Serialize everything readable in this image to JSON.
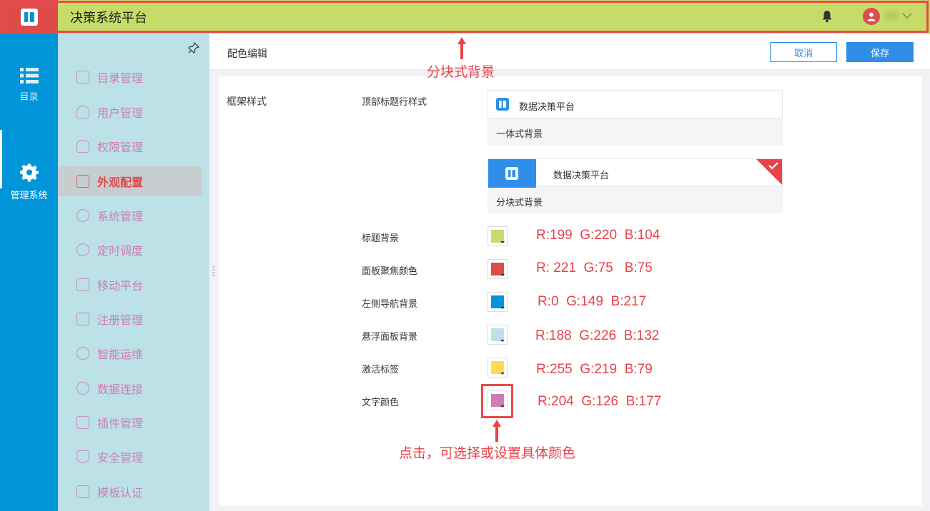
{
  "header": {
    "app_title": "决策系统平台",
    "logo": "fine-logo-icon",
    "bell_icon": "bell-icon",
    "avatar_icon": "user-avatar-icon",
    "dropdown_icon": "chevron-down-icon",
    "background_color": "#C7DC68"
  },
  "left_nav": {
    "items": [
      {
        "label": "目录",
        "icon": "list-icon"
      },
      {
        "label": "管理系统",
        "icon": "gear-icon"
      }
    ],
    "background_color": "#0095D9"
  },
  "sidebar": {
    "pin_icon": "pin-icon",
    "items": [
      {
        "label": "目录管理",
        "icon": "catalog-icon"
      },
      {
        "label": "用户管理",
        "icon": "user-icon"
      },
      {
        "label": "权限管理",
        "icon": "lock-icon"
      },
      {
        "label": "外观配置",
        "icon": "paint-roller-icon",
        "active": true
      },
      {
        "label": "系统管理",
        "icon": "gear-icon"
      },
      {
        "label": "定时调度",
        "icon": "stopwatch-icon"
      },
      {
        "label": "移动平台",
        "icon": "tablet-icon"
      },
      {
        "label": "注册管理",
        "icon": "register-icon"
      },
      {
        "label": "智能运维",
        "icon": "network-icon"
      },
      {
        "label": "数据连接",
        "icon": "paperclip-icon"
      },
      {
        "label": "插件管理",
        "icon": "puzzle-icon"
      },
      {
        "label": "安全管理",
        "icon": "shield-icon"
      },
      {
        "label": "模板认证",
        "icon": "template-icon"
      }
    ],
    "background_color": "#BCE2E8",
    "text_color": "#CC7EB1"
  },
  "content": {
    "title": "配色编辑",
    "cancel_label": "取消",
    "save_label": "保存",
    "section_label": "框架样式",
    "header_style_label": "顶部标题行样式",
    "options": [
      {
        "title": "数据决策平台",
        "label": "一体式背景",
        "selected": false
      },
      {
        "title": "数据决策平台",
        "label": "分块式背景",
        "selected": true
      }
    ],
    "colors": [
      {
        "label": "标题背景",
        "hex": "#C7DC68",
        "rgb": "R:199  G:220  B:104"
      },
      {
        "label": "面板聚焦颜色",
        "hex": "#DD4B4B",
        "rgb": "R: 221  G:75   B:75"
      },
      {
        "label": "左侧导航背景",
        "hex": "#0095D9",
        "rgb": "R:0  G:149  B:217"
      },
      {
        "label": "悬浮面板背景",
        "hex": "#BCE2E8",
        "rgb": "R:188  G:226  B:132"
      },
      {
        "label": "激活标签",
        "hex": "#FFDB4F",
        "rgb": "R:255  G:219  B:79"
      },
      {
        "label": "文字颜色",
        "hex": "#CC7EB1",
        "rgb": "R:204  G:126  B:177"
      }
    ]
  },
  "annotations": {
    "header_note": "分块式背景",
    "swatch_note": "点击，可选择或设置具体颜色",
    "color": "#E8424A"
  }
}
